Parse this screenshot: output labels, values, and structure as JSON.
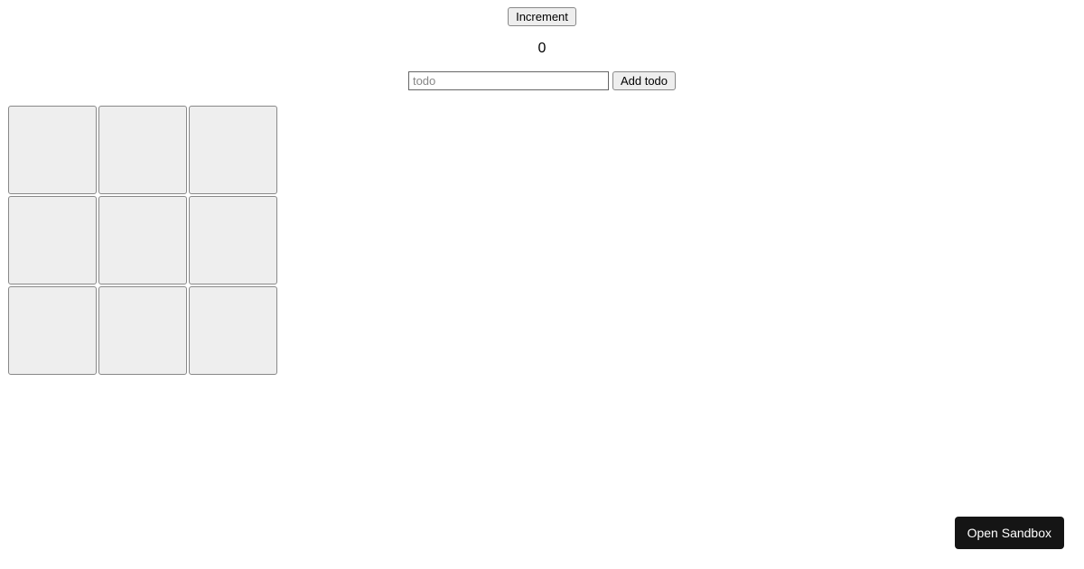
{
  "counter": {
    "increment_label": "Increment",
    "value": "0"
  },
  "todo": {
    "placeholder": "todo",
    "add_label": "Add todo"
  },
  "sandbox": {
    "open_label": "Open Sandbox"
  }
}
